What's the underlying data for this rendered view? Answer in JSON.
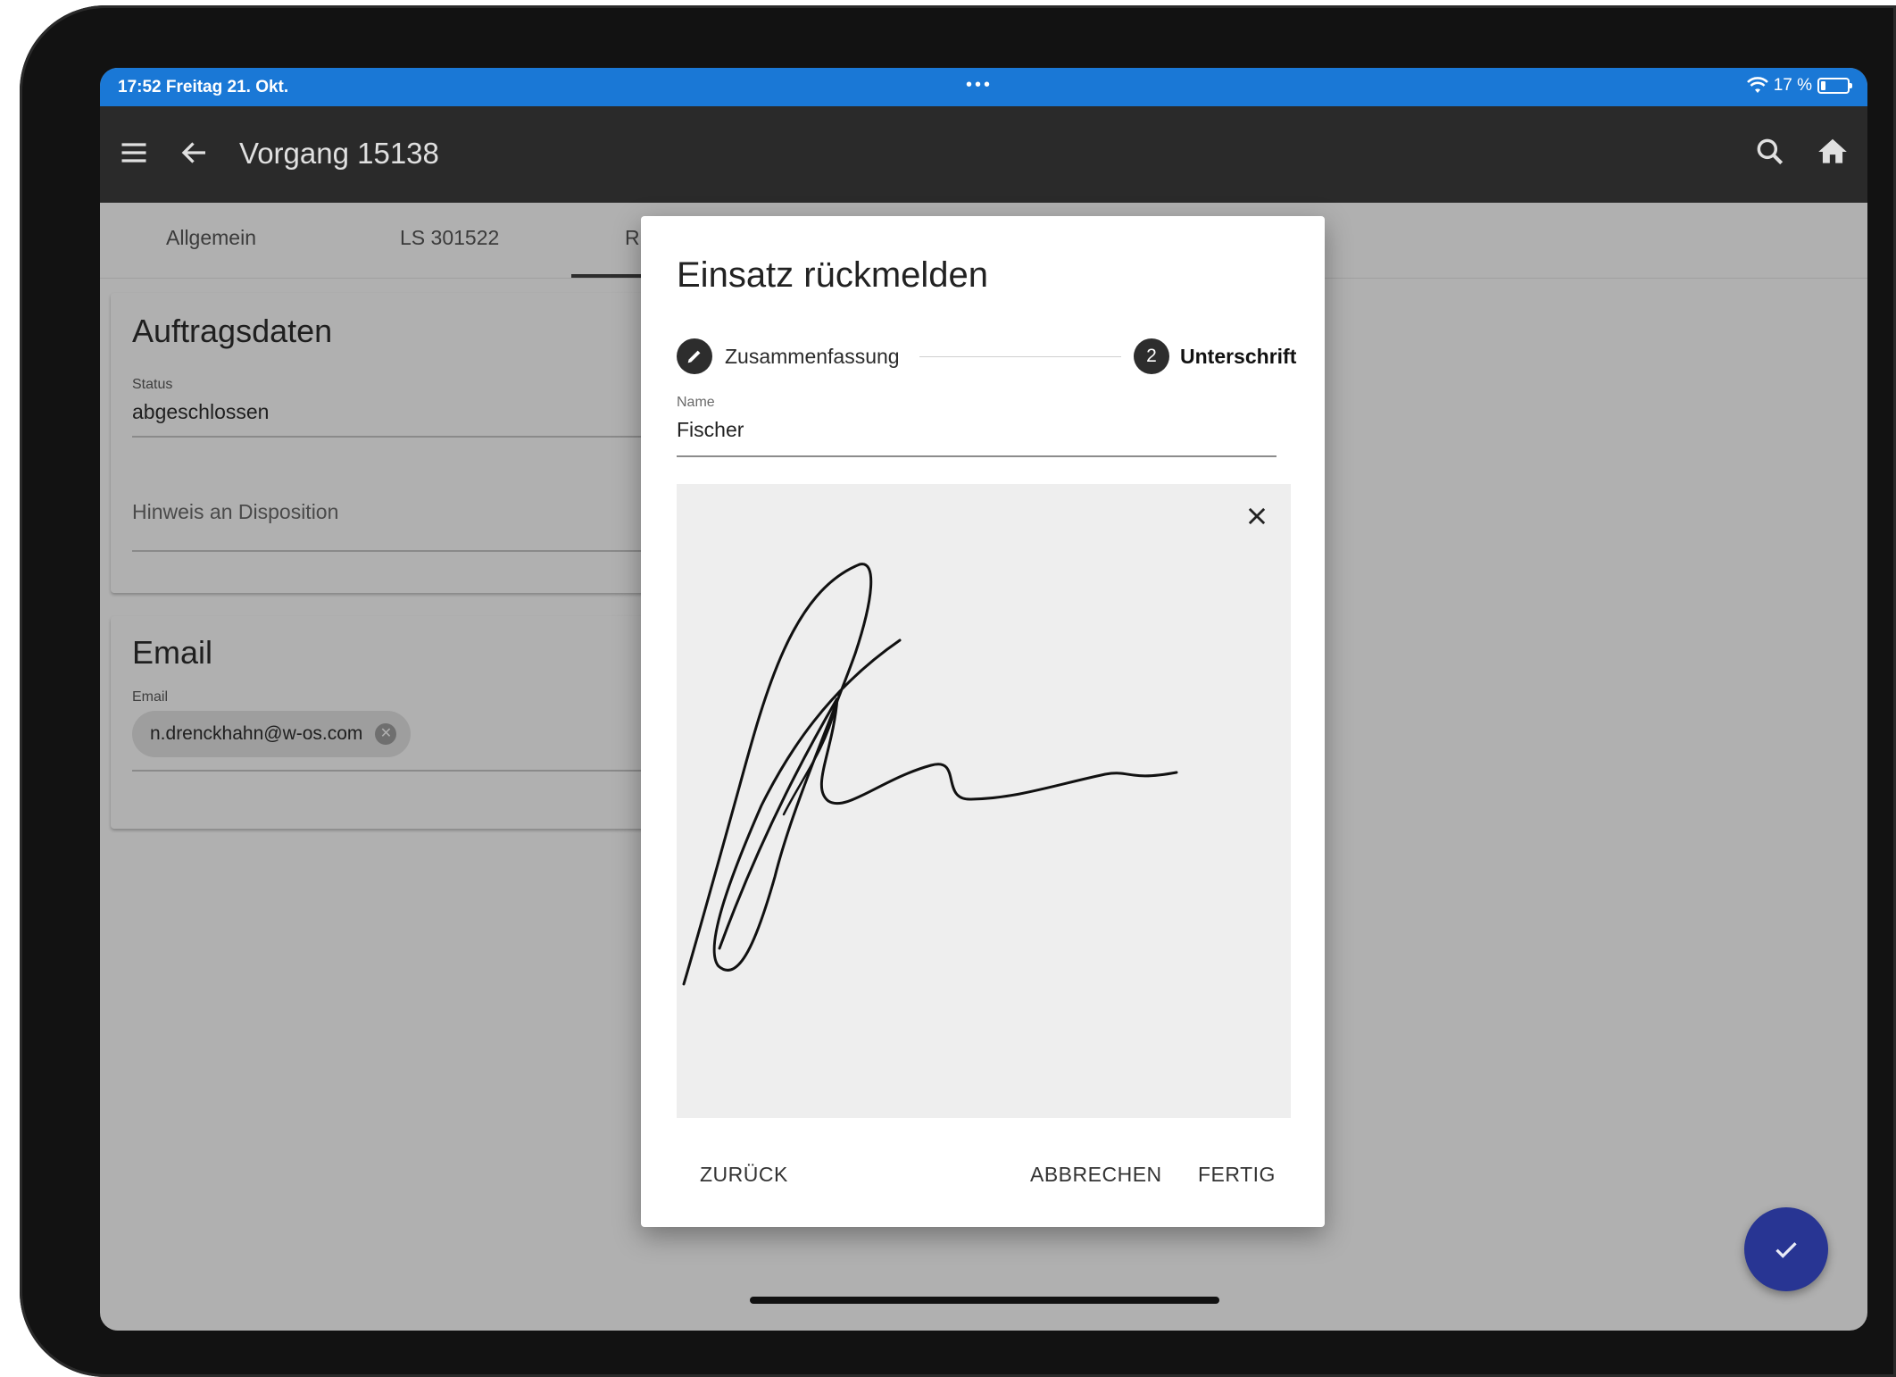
{
  "status_bar": {
    "time_date": "17:52  Freitag 21. Okt.",
    "dots": "•••",
    "battery": "17 %",
    "battery_level": 0.17
  },
  "app_bar": {
    "title": "Vorgang 15138",
    "menu_icon": "menu-icon",
    "back_icon": "arrow-left-icon",
    "search_icon": "search-icon",
    "home_icon": "home-icon"
  },
  "tabs": [
    {
      "label": "Allgemein"
    },
    {
      "label": "LS 301522"
    },
    {
      "label": "R"
    }
  ],
  "auftragsdaten": {
    "title": "Auftragsdaten",
    "status_label": "Status",
    "status_value": "abgeschlossen",
    "hinweis_placeholder": "Hinweis an Disposition"
  },
  "email_card": {
    "title": "Email",
    "field_label": "Email",
    "chip": "n.drenckhahn@w-os.com"
  },
  "dialog": {
    "title": "Einsatz rückmelden",
    "steps": [
      {
        "icon": "pencil-icon",
        "label": "Zusammenfassung"
      },
      {
        "number": "2",
        "label": "Unterschrift"
      }
    ],
    "name_label": "Name",
    "name_value": "Fischer",
    "buttons": {
      "back": "ZURÜCK",
      "cancel": "ABBRECHEN",
      "done": "FERTIG"
    }
  },
  "fab_icon": "check-icon",
  "colors": {
    "status_bar": "#1a78d6",
    "app_bar": "#2a2a2a",
    "fab": "#283593",
    "overlay_bg": "#b0b0b0"
  }
}
